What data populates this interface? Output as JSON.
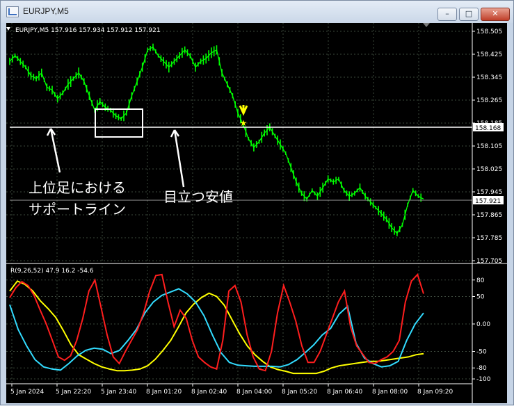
{
  "window": {
    "title": "EURJPY,M5",
    "buttons": {
      "minimize": "–",
      "maximize": "□",
      "close": "✕"
    }
  },
  "chart": {
    "info": "EURJPY,M5  157.916 157.934 157.912 157.921",
    "price_axis": [
      "158.505",
      "158.425",
      "158.345",
      "158.265",
      "158.185",
      "158.105",
      "158.025",
      "157.945",
      "157.865",
      "157.785",
      "157.705"
    ],
    "price_range": [
      157.705,
      158.505
    ],
    "price_labels": {
      "support": "158.168",
      "current": "157.921"
    },
    "time_axis": [
      "5 Jan 2024",
      "5 Jan 22:20",
      "5 Jan 23:40",
      "8 Jan 01:20",
      "8 Jan 02:40",
      "8 Jan 04:00",
      "8 Jan 05:20",
      "8 Jan 06:40",
      "8 Jan 08:00",
      "8 Jan 09:20"
    ],
    "annotations": {
      "support_line_1": "上位足における",
      "support_line_2": "サポートライン",
      "cheap_value": "目立つ安値"
    },
    "colors": {
      "candles": "#00ff00",
      "annotation": "#ffffff",
      "marker": "#ffff00"
    }
  },
  "indicator": {
    "label": "R(9,26,52) 47.9 16.2 -54.6",
    "axis": [
      "80",
      "50",
      "0.00",
      "-50",
      "-80",
      "-100"
    ],
    "range": [
      -105,
      105
    ],
    "colors": {
      "fast": "#ff1e1e",
      "mid": "#32dcff",
      "slow": "#ffff00"
    }
  },
  "chart_data": {
    "type": "line",
    "series": [
      {
        "values": [
          158.4,
          158.42,
          158.4,
          158.38,
          158.35,
          158.34,
          158.36,
          158.31,
          158.3,
          158.27,
          158.29,
          158.32,
          158.34,
          158.36,
          158.33,
          158.28,
          158.23,
          158.26,
          158.24,
          158.23,
          158.21,
          158.2,
          158.22,
          158.28,
          158.33,
          158.38,
          158.44,
          158.45,
          158.42,
          158.4,
          158.38,
          158.4,
          158.42,
          158.44,
          158.42,
          158.38,
          158.4,
          158.41,
          158.43,
          158.44,
          158.36,
          158.32,
          158.28,
          158.22,
          158.18,
          158.13,
          158.1,
          158.12,
          158.15,
          158.17,
          158.14,
          158.11,
          158.08,
          158.03,
          157.98,
          157.94,
          157.92,
          157.95,
          157.93,
          157.96,
          157.99,
          157.98,
          157.99,
          157.95,
          157.93,
          157.94,
          157.96,
          157.93,
          157.91,
          157.89,
          157.87,
          157.85,
          157.82,
          157.8,
          157.83,
          157.9,
          157.95,
          157.93,
          157.92
        ]
      },
      {
        "name": "R",
        "values": [
          48,
          66,
          77,
          70,
          52,
          25,
          0,
          -30,
          -60,
          -66,
          -58,
          -30,
          10,
          60,
          80,
          30,
          -20,
          -60,
          -72,
          -50,
          -30,
          -10,
          20,
          60,
          88,
          90,
          40,
          -5,
          25,
          10,
          -30,
          -60,
          -70,
          -78,
          -82,
          -30,
          60,
          70,
          40,
          -20,
          -60,
          -82,
          -85,
          -50,
          20,
          70,
          40,
          5,
          -40,
          -70,
          -70,
          -50,
          -20,
          10,
          40,
          60,
          -5,
          -40,
          -55,
          -70,
          -72,
          -65,
          -60,
          -50,
          -30,
          40,
          78,
          90,
          55
        ]
      },
      {
        "name": "R",
        "values": [
          35,
          -10,
          -40,
          -65,
          -78,
          -82,
          -84,
          -72,
          -58,
          -48,
          -44,
          -46,
          -54,
          -48,
          -30,
          -10,
          20,
          40,
          52,
          58,
          64,
          55,
          40,
          15,
          -20,
          -52,
          -70,
          -75,
          -76,
          -77,
          -77,
          -77,
          -78,
          -74,
          -65,
          -52,
          -38,
          -20,
          -8,
          18,
          32,
          -35,
          -62,
          -72,
          -78,
          -76,
          -68,
          -30,
          0,
          20
        ]
      },
      {
        "name": "R",
        "values": [
          60,
          78,
          72,
          60,
          42,
          28,
          12,
          -12,
          -38,
          -56,
          -64,
          -72,
          -78,
          -82,
          -85,
          -85,
          -84,
          -82,
          -76,
          -64,
          -48,
          -30,
          -6,
          20,
          36,
          48,
          56,
          50,
          34,
          8,
          -18,
          -40,
          -56,
          -68,
          -78,
          -83,
          -86,
          -90,
          -90,
          -90,
          -90,
          -86,
          -80,
          -76,
          -74,
          -72,
          -70,
          -68,
          -68,
          -66,
          -64,
          -62,
          -60,
          -56,
          -54
        ]
      }
    ]
  }
}
